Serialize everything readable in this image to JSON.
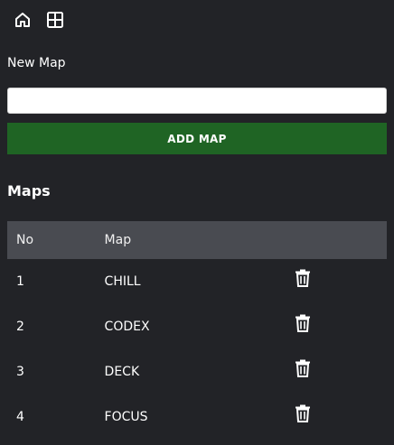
{
  "nav": {
    "home_icon": "home-icon",
    "grid_icon": "grid-icon"
  },
  "form": {
    "label": "New Map",
    "input_value": "",
    "input_placeholder": "",
    "add_button": "ADD MAP"
  },
  "maps": {
    "title": "Maps",
    "columns": [
      "No",
      "Map"
    ],
    "rows": [
      {
        "no": "1",
        "map": "CHILL"
      },
      {
        "no": "2",
        "map": "CODEX"
      },
      {
        "no": "3",
        "map": "DECK"
      },
      {
        "no": "4",
        "map": "FOCUS"
      }
    ],
    "delete_icon": "trash-icon"
  },
  "colors": {
    "background": "#222327",
    "header_row": "#494b51",
    "accent_green": "#1f6424"
  }
}
